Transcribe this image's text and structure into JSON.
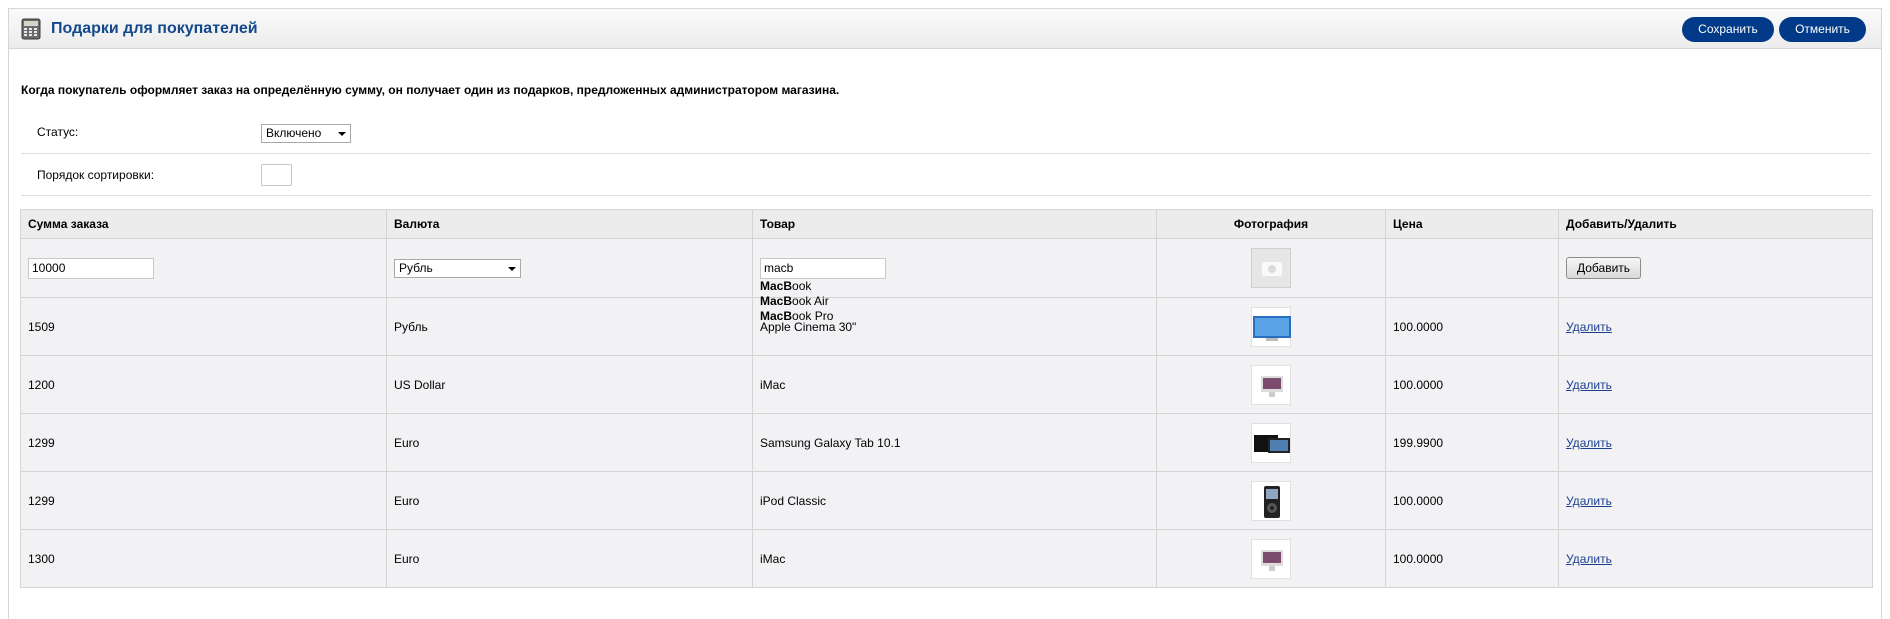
{
  "header": {
    "title": "Подарки для покупателей",
    "save_label": "Сохранить",
    "cancel_label": "Отменить",
    "icon": "calculator-icon"
  },
  "description": "Когда покупатель оформляет заказ на определённую сумму, он получает один из подарков, предложенных администратором магазина.",
  "form": {
    "status_label": "Статус:",
    "status_value": "Включено",
    "sort_label": "Порядок сортировки:",
    "sort_value": ""
  },
  "table": {
    "headers": [
      "Сумма заказа",
      "Валюта",
      "Товар",
      "Фотография",
      "Цена",
      "Добавить/Удалить"
    ],
    "new_row": {
      "amount": "10000",
      "currency": "Рубль",
      "product_query": "macb",
      "photo": "placeholder-photo-icon",
      "add_label": "Добавить"
    },
    "autocomplete": [
      {
        "match": "MacB",
        "rest": "ook"
      },
      {
        "match": "MacB",
        "rest": "ook Air"
      },
      {
        "match": "MacB",
        "rest": "ook Pro"
      }
    ],
    "rows": [
      {
        "amount": "1509",
        "currency": "Рубль",
        "product": "Apple Cinema 30\"",
        "photo": "monitor-thumb",
        "price": "100.0000",
        "action": "Удалить"
      },
      {
        "amount": "1200",
        "currency": "US Dollar",
        "product": "iMac",
        "photo": "imac-thumb",
        "price": "100.0000",
        "action": "Удалить"
      },
      {
        "amount": "1299",
        "currency": "Euro",
        "product": "Samsung Galaxy Tab 10.1",
        "photo": "tablet-thumb",
        "price": "199.9900",
        "action": "Удалить"
      },
      {
        "amount": "1299",
        "currency": "Euro",
        "product": "iPod Classic",
        "photo": "ipod-thumb",
        "price": "100.0000",
        "action": "Удалить"
      },
      {
        "amount": "1300",
        "currency": "Euro",
        "product": "iMac",
        "photo": "imac-thumb",
        "price": "100.0000",
        "action": "Удалить"
      }
    ]
  },
  "colors": {
    "title": "#13488c",
    "button_bg": "#003a88",
    "link": "#1c3f8f"
  }
}
